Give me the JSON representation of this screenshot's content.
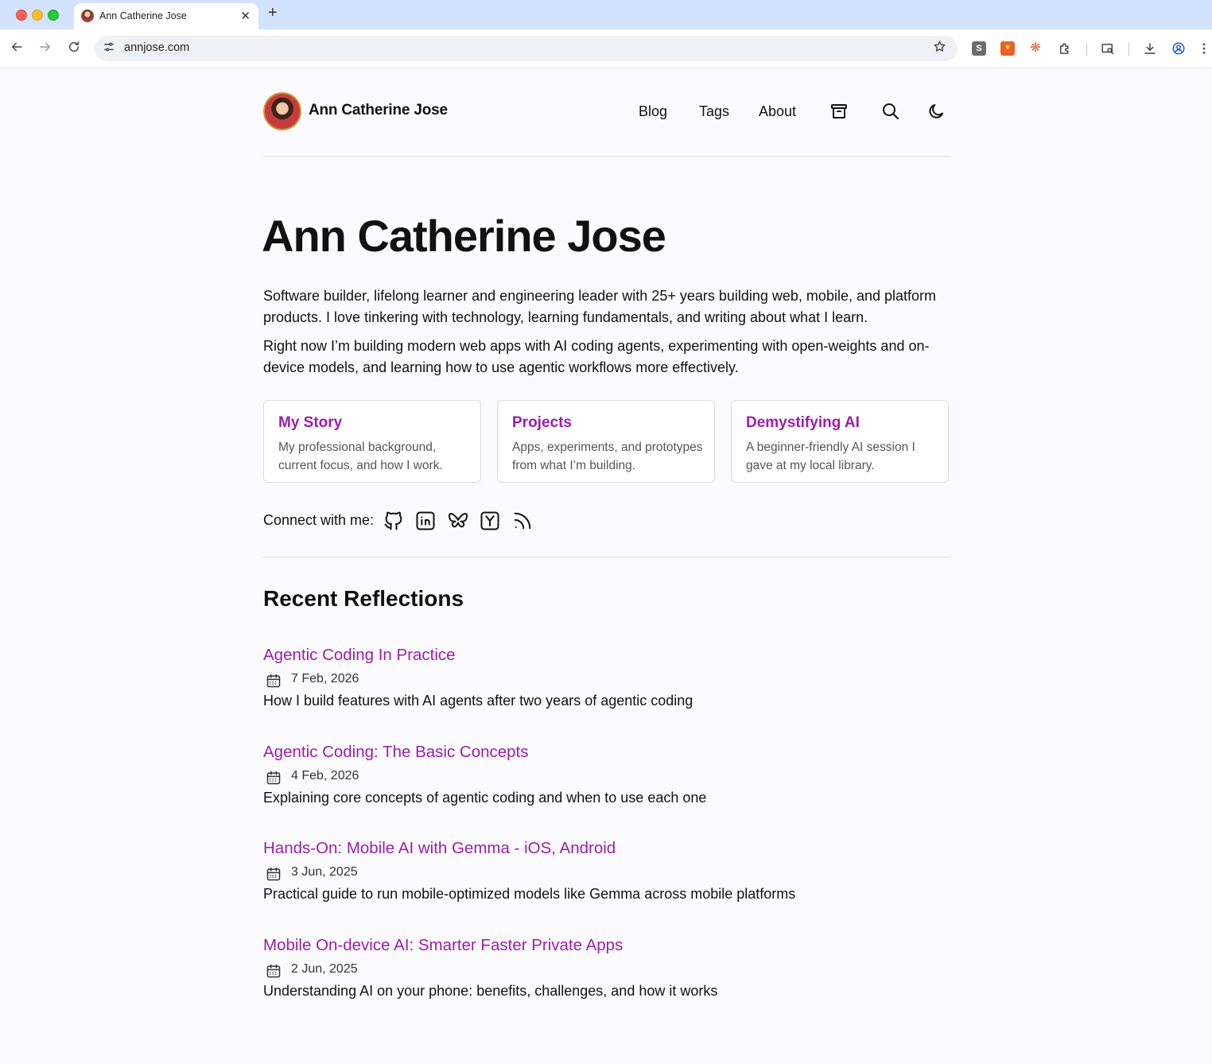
{
  "browser": {
    "tab_title": "Ann Catherine Jose",
    "tab_close": "✕",
    "new_tab": "+",
    "url": "annjose.com"
  },
  "header": {
    "brand": "Ann Catherine Jose",
    "nav": {
      "blog": "Blog",
      "tags": "Tags",
      "about": "About"
    }
  },
  "hero": {
    "title": "Ann Catherine Jose",
    "bio_1": "Software builder, lifelong learner and engineering leader with 25+ years building web, mobile, and platform products. I love tinkering with technology, learning fundamentals, and writing about what I learn.",
    "bio_2": "Right now I’m building modern web apps with AI coding agents, experimenting with open-weights and on-device models, and learning how to use agentic workflows more effectively."
  },
  "cards": [
    {
      "title": "My Story",
      "desc": "My professional background, current focus, and how I work."
    },
    {
      "title": "Projects",
      "desc": "Apps, experiments, and prototypes from what I’m building."
    },
    {
      "title": "Demystifying AI",
      "desc": "A beginner-friendly AI session I gave at my local library."
    }
  ],
  "connect": {
    "label": "Connect with me:"
  },
  "recent": {
    "title": "Recent Reflections",
    "posts": [
      {
        "title": "Agentic Coding In Practice",
        "date": "7 Feb, 2026",
        "desc": "How I build features with AI agents after two years of agentic coding"
      },
      {
        "title": "Agentic Coding: The Basic Concepts",
        "date": "4 Feb, 2026",
        "desc": "Explaining core concepts of agentic coding and when to use each one"
      },
      {
        "title": "Hands-On: Mobile AI with Gemma - iOS, Android",
        "date": "3 Jun, 2025",
        "desc": "Practical guide to run mobile-optimized models like Gemma across mobile platforms"
      },
      {
        "title": "Mobile On-device AI: Smarter Faster Private Apps",
        "date": "2 Jun, 2025",
        "desc": "Understanding AI on your phone: benefits, challenges, and how it works"
      }
    ]
  },
  "colors": {
    "accent": "#9b1eaa",
    "text": "#111111",
    "muted": "#555555",
    "background": "#fbfbfd"
  }
}
